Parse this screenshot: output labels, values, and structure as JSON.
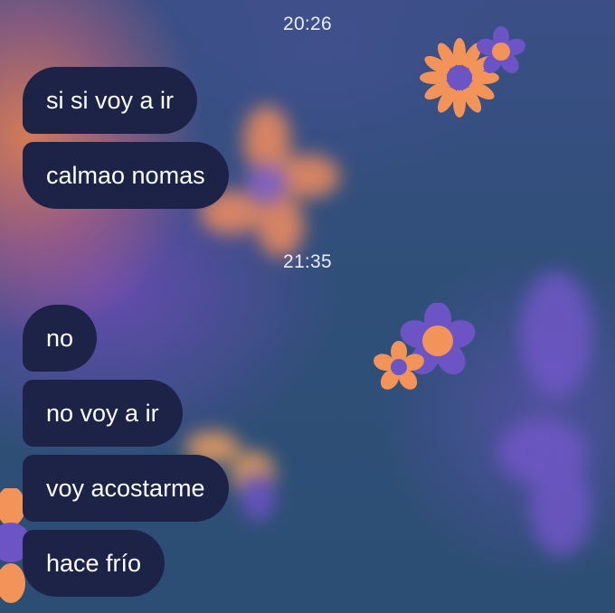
{
  "chat": {
    "groups": [
      {
        "time": "20:26",
        "messages": [
          "si si voy a ir",
          "calmao nomas"
        ]
      },
      {
        "time": "21:35",
        "messages": [
          "no",
          "no voy a ir",
          "voy acostarme",
          "hace frío"
        ]
      }
    ]
  },
  "theme": {
    "bubble_color": "#1c2347",
    "bubble_text_color": "#ffffff",
    "flower_orange": "#f2935a",
    "flower_purple": "#6d54c4"
  },
  "wallpaper": {
    "decoration_icons": [
      "flower-icon"
    ]
  }
}
